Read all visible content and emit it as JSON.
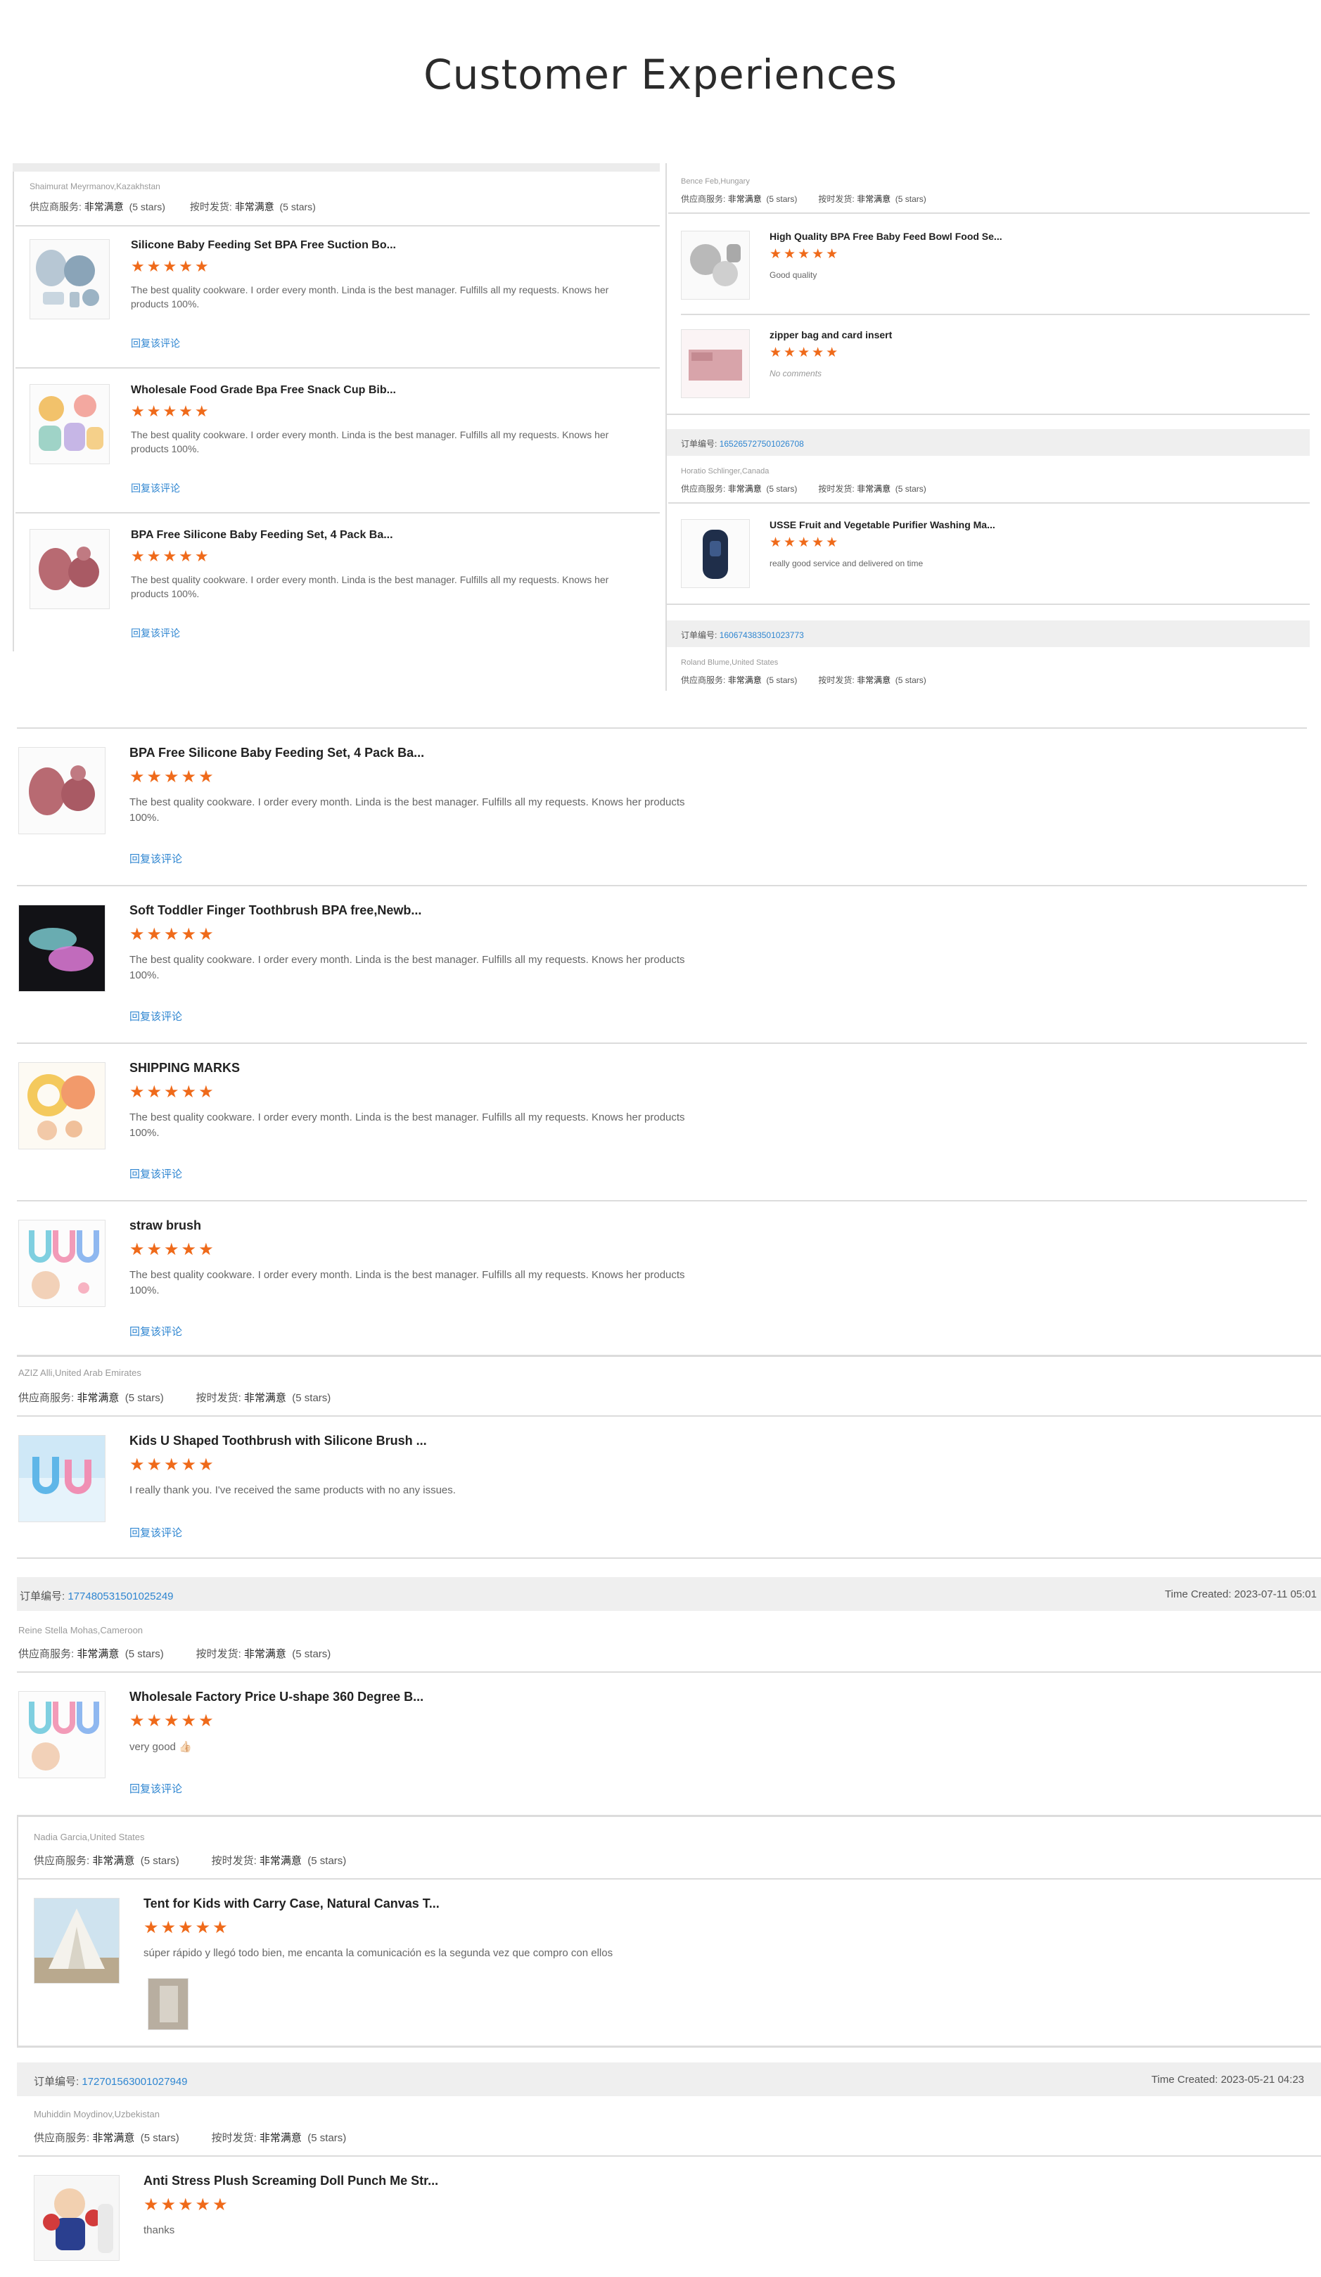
{
  "page": {
    "title": "Customer Experiences"
  },
  "labels": {
    "supplier_service": "供应商服务:",
    "on_time": "按时发货:",
    "very_satisfied": "非常满意",
    "five_stars": "(5 stars)",
    "order_no": "订单编号:",
    "reply": "回复该评论",
    "stars": "★★★★★"
  },
  "top_left": {
    "buyer": "Shaimurat Meyrmanov,Kazakhstan",
    "items": [
      {
        "title": "Silicone Baby Feeding Set BPA Free Suction Bo...",
        "comment": "The best quality cookware. I order every month. Linda is the best manager. Fulfills all my requests. Knows her products 100%."
      },
      {
        "title": "Wholesale Food Grade Bpa Free Snack Cup Bib...",
        "comment": "The best quality cookware. I order every month. Linda is the best manager. Fulfills all my requests. Knows her products 100%."
      },
      {
        "title": "BPA Free Silicone Baby Feeding Set, 4 Pack Ba...",
        "comment": "The best quality cookware. I order every month. Linda is the best manager. Fulfills all my requests. Knows her products 100%."
      }
    ]
  },
  "top_right": {
    "block1": {
      "buyer": "Bence Feb,Hungary",
      "items": [
        {
          "title": "High Quality BPA Free Baby Feed Bowl Food Se...",
          "comment": "Good quality"
        },
        {
          "title": "zipper bag and card insert",
          "comment": "No comments"
        }
      ]
    },
    "block2": {
      "order_id": "165265727501026708",
      "buyer": "Horatio Schlinger,Canada",
      "items": [
        {
          "title": "USSE Fruit and Vegetable Purifier Washing Ma...",
          "comment": "really good service and delivered on time"
        }
      ]
    },
    "block3": {
      "order_id": "160674383501023773",
      "buyer": "Roland Blume,United States"
    }
  },
  "list": {
    "items": [
      {
        "title": "BPA Free Silicone Baby Feeding Set, 4 Pack Ba...",
        "comment": "The best quality cookware. I order every month. Linda is the best manager. Fulfills all my requests. Knows her products 100%."
      },
      {
        "title": "Soft Toddler Finger Toothbrush BPA free,Newb...",
        "comment": "The best quality cookware. I order every month. Linda is the best manager. Fulfills all my requests. Knows her products 100%."
      },
      {
        "title": "SHIPPING MARKS",
        "comment": "The best quality cookware. I order every month. Linda is the best manager. Fulfills all my requests. Knows her products 100%."
      },
      {
        "title": "straw brush",
        "comment": "The best quality cookware. I order every month. Linda is the best manager. Fulfills all my requests. Knows her products 100%."
      }
    ]
  },
  "aziz": {
    "buyer": "AZIZ Alli,United Arab Emirates",
    "item": {
      "title": "Kids U Shaped Toothbrush with Silicone Brush ...",
      "comment": "I really thank you. I've received the same products with no any issues."
    }
  },
  "reine": {
    "order_id": "177480531501025249",
    "time_created": "Time Created: 2023-07-11 05:01",
    "buyer": "Reine Stella Mohas,Cameroon",
    "item": {
      "title": "Wholesale Factory Price U-shape 360 Degree B...",
      "comment": "very good 👍🏻"
    }
  },
  "nadia": {
    "buyer": "Nadia Garcia,United States",
    "item": {
      "title": "Tent for Kids with Carry Case, Natural Canvas T...",
      "comment": "súper rápido y llegó todo bien, me encanta la comunicación es la segunda vez que compro con ellos"
    }
  },
  "muhiddin": {
    "order_id": "172701563001027949",
    "time_created": "Time Created: 2023-05-21 04:23",
    "buyer": "Muhiddin Moydinov,Uzbekistan",
    "item": {
      "title": "Anti Stress Plush Screaming Doll Punch Me Str...",
      "comment": "thanks"
    }
  },
  "colors": {
    "star": "#ef6a1a",
    "link": "#2f86d1",
    "bar": "#efefef"
  }
}
